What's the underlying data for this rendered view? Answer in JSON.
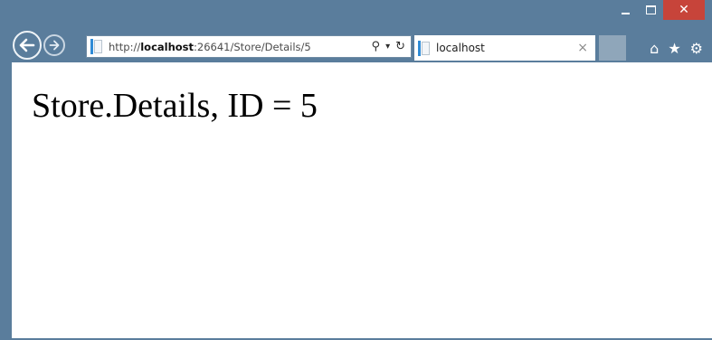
{
  "window": {
    "controls": {
      "minimize_icon": "minimize-icon",
      "maximize_icon": "maximize-icon",
      "close_glyph": "✕"
    }
  },
  "nav": {
    "back_icon": "back-arrow-icon",
    "forward_icon": "forward-arrow-icon"
  },
  "address_bar": {
    "url_prefix": "http://",
    "url_host": "localhost",
    "url_rest": ":26641/Store/Details/5",
    "search_glyph": "⚲",
    "dropdown_glyph": "▾",
    "refresh_glyph": "↻"
  },
  "tab": {
    "title": "localhost",
    "close_glyph": "×"
  },
  "toolbar": {
    "home_glyph": "⌂",
    "favorites_glyph": "★",
    "settings_glyph": "⚙"
  },
  "page": {
    "heading": "Store.Details, ID = 5"
  },
  "colors": {
    "frame": "#5a7d9c",
    "close_button": "#c7443a",
    "content_bg": "#ffffff",
    "new_tab_bg": "#8fa6ba"
  }
}
